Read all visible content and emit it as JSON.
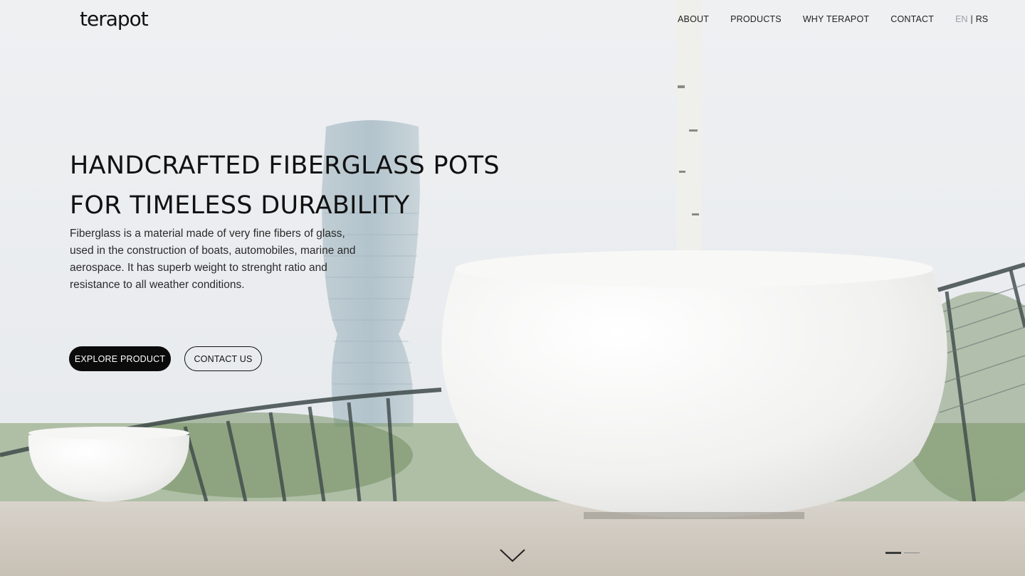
{
  "header": {
    "logo": "terapot",
    "nav": [
      "ABOUT",
      "PRODUCTS",
      "WHY TERAPOT",
      "CONTACT"
    ],
    "lang": {
      "en": "EN",
      "separator": "|",
      "rs": "RS"
    }
  },
  "hero": {
    "title_line1": "HANDCRAFTED FIBERGLASS POTS",
    "title_line2": "FOR TIMELESS DURABILITY",
    "description": "Fiberglass is a material made of very fine fibers of glass, used in the construction of boats, automobiles, marine and aerospace. It has superb weight to strenght ratio and resistance to all weather conditions.",
    "buttons": {
      "explore": "EXPLORE PRODUCT",
      "contact": "CONTACT US"
    }
  },
  "slider": {
    "count": 2,
    "active": 1
  },
  "icons": {
    "scroll": "chevron-down-icon"
  }
}
